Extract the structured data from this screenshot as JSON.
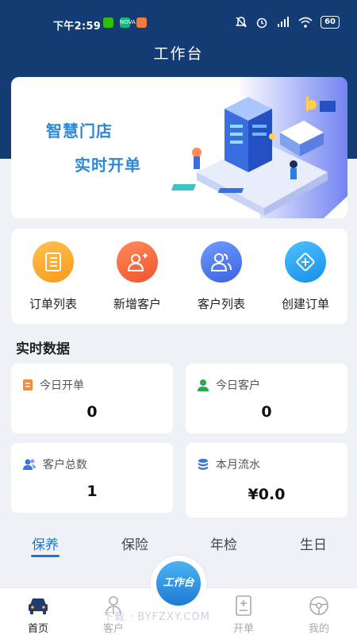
{
  "status_bar": {
    "time": "下午2:59",
    "app_icons": [
      {
        "name": "wechat-icon",
        "color": "#2dc100",
        "text": ""
      },
      {
        "name": "app-badge-icon",
        "color": "#17b47b",
        "text": "NOVA"
      },
      {
        "name": "orange-app-icon",
        "color": "#f07d3c",
        "text": ""
      }
    ],
    "battery": "60"
  },
  "header": {
    "title": "工作台",
    "bg_color": "#123c73"
  },
  "banner": {
    "line1": "智慧门店",
    "line2": "实时开单"
  },
  "quick_actions": [
    {
      "label": "订单列表",
      "icon": "order-list-icon",
      "color_from": "#ffc14d",
      "color_to": "#f79a1e"
    },
    {
      "label": "新增客户",
      "icon": "add-user-icon",
      "color_from": "#ff8a5a",
      "color_to": "#f0542d"
    },
    {
      "label": "客户列表",
      "icon": "users-icon",
      "color_from": "#6f9bff",
      "color_to": "#3b63e0"
    },
    {
      "label": "创建订单",
      "icon": "create-order-icon",
      "color_from": "#49c2ff",
      "color_to": "#1a8ee8"
    }
  ],
  "realtime": {
    "title": "实时数据",
    "cards": [
      {
        "label": "今日开单",
        "value": "0",
        "icon": "document-icon",
        "icon_color": "#f28c38"
      },
      {
        "label": "今日客户",
        "value": "0",
        "icon": "person-icon",
        "icon_color": "#2ea54f"
      },
      {
        "label": "客户总数",
        "value": "1",
        "icon": "people-icon",
        "icon_color": "#3d76d9"
      },
      {
        "label": "本月流水",
        "value": "¥0.0",
        "icon": "coins-icon",
        "icon_color": "#3d76d9"
      }
    ]
  },
  "tabs": [
    {
      "label": "保养",
      "active": true
    },
    {
      "label": "保险",
      "active": false
    },
    {
      "label": "年检",
      "active": false
    },
    {
      "label": "生日",
      "active": false
    }
  ],
  "center_button": "工作台",
  "bottom_nav": [
    {
      "label": "首页",
      "icon": "car-icon",
      "active": true
    },
    {
      "label": "客户",
      "icon": "customer-icon",
      "active": false
    },
    {
      "label": "开单",
      "icon": "billing-icon",
      "active": false
    },
    {
      "label": "我的",
      "icon": "steering-wheel-icon",
      "active": false
    }
  ],
  "watermark": "下载 · BYFZXY.COM",
  "accent_color": "#2276c9"
}
